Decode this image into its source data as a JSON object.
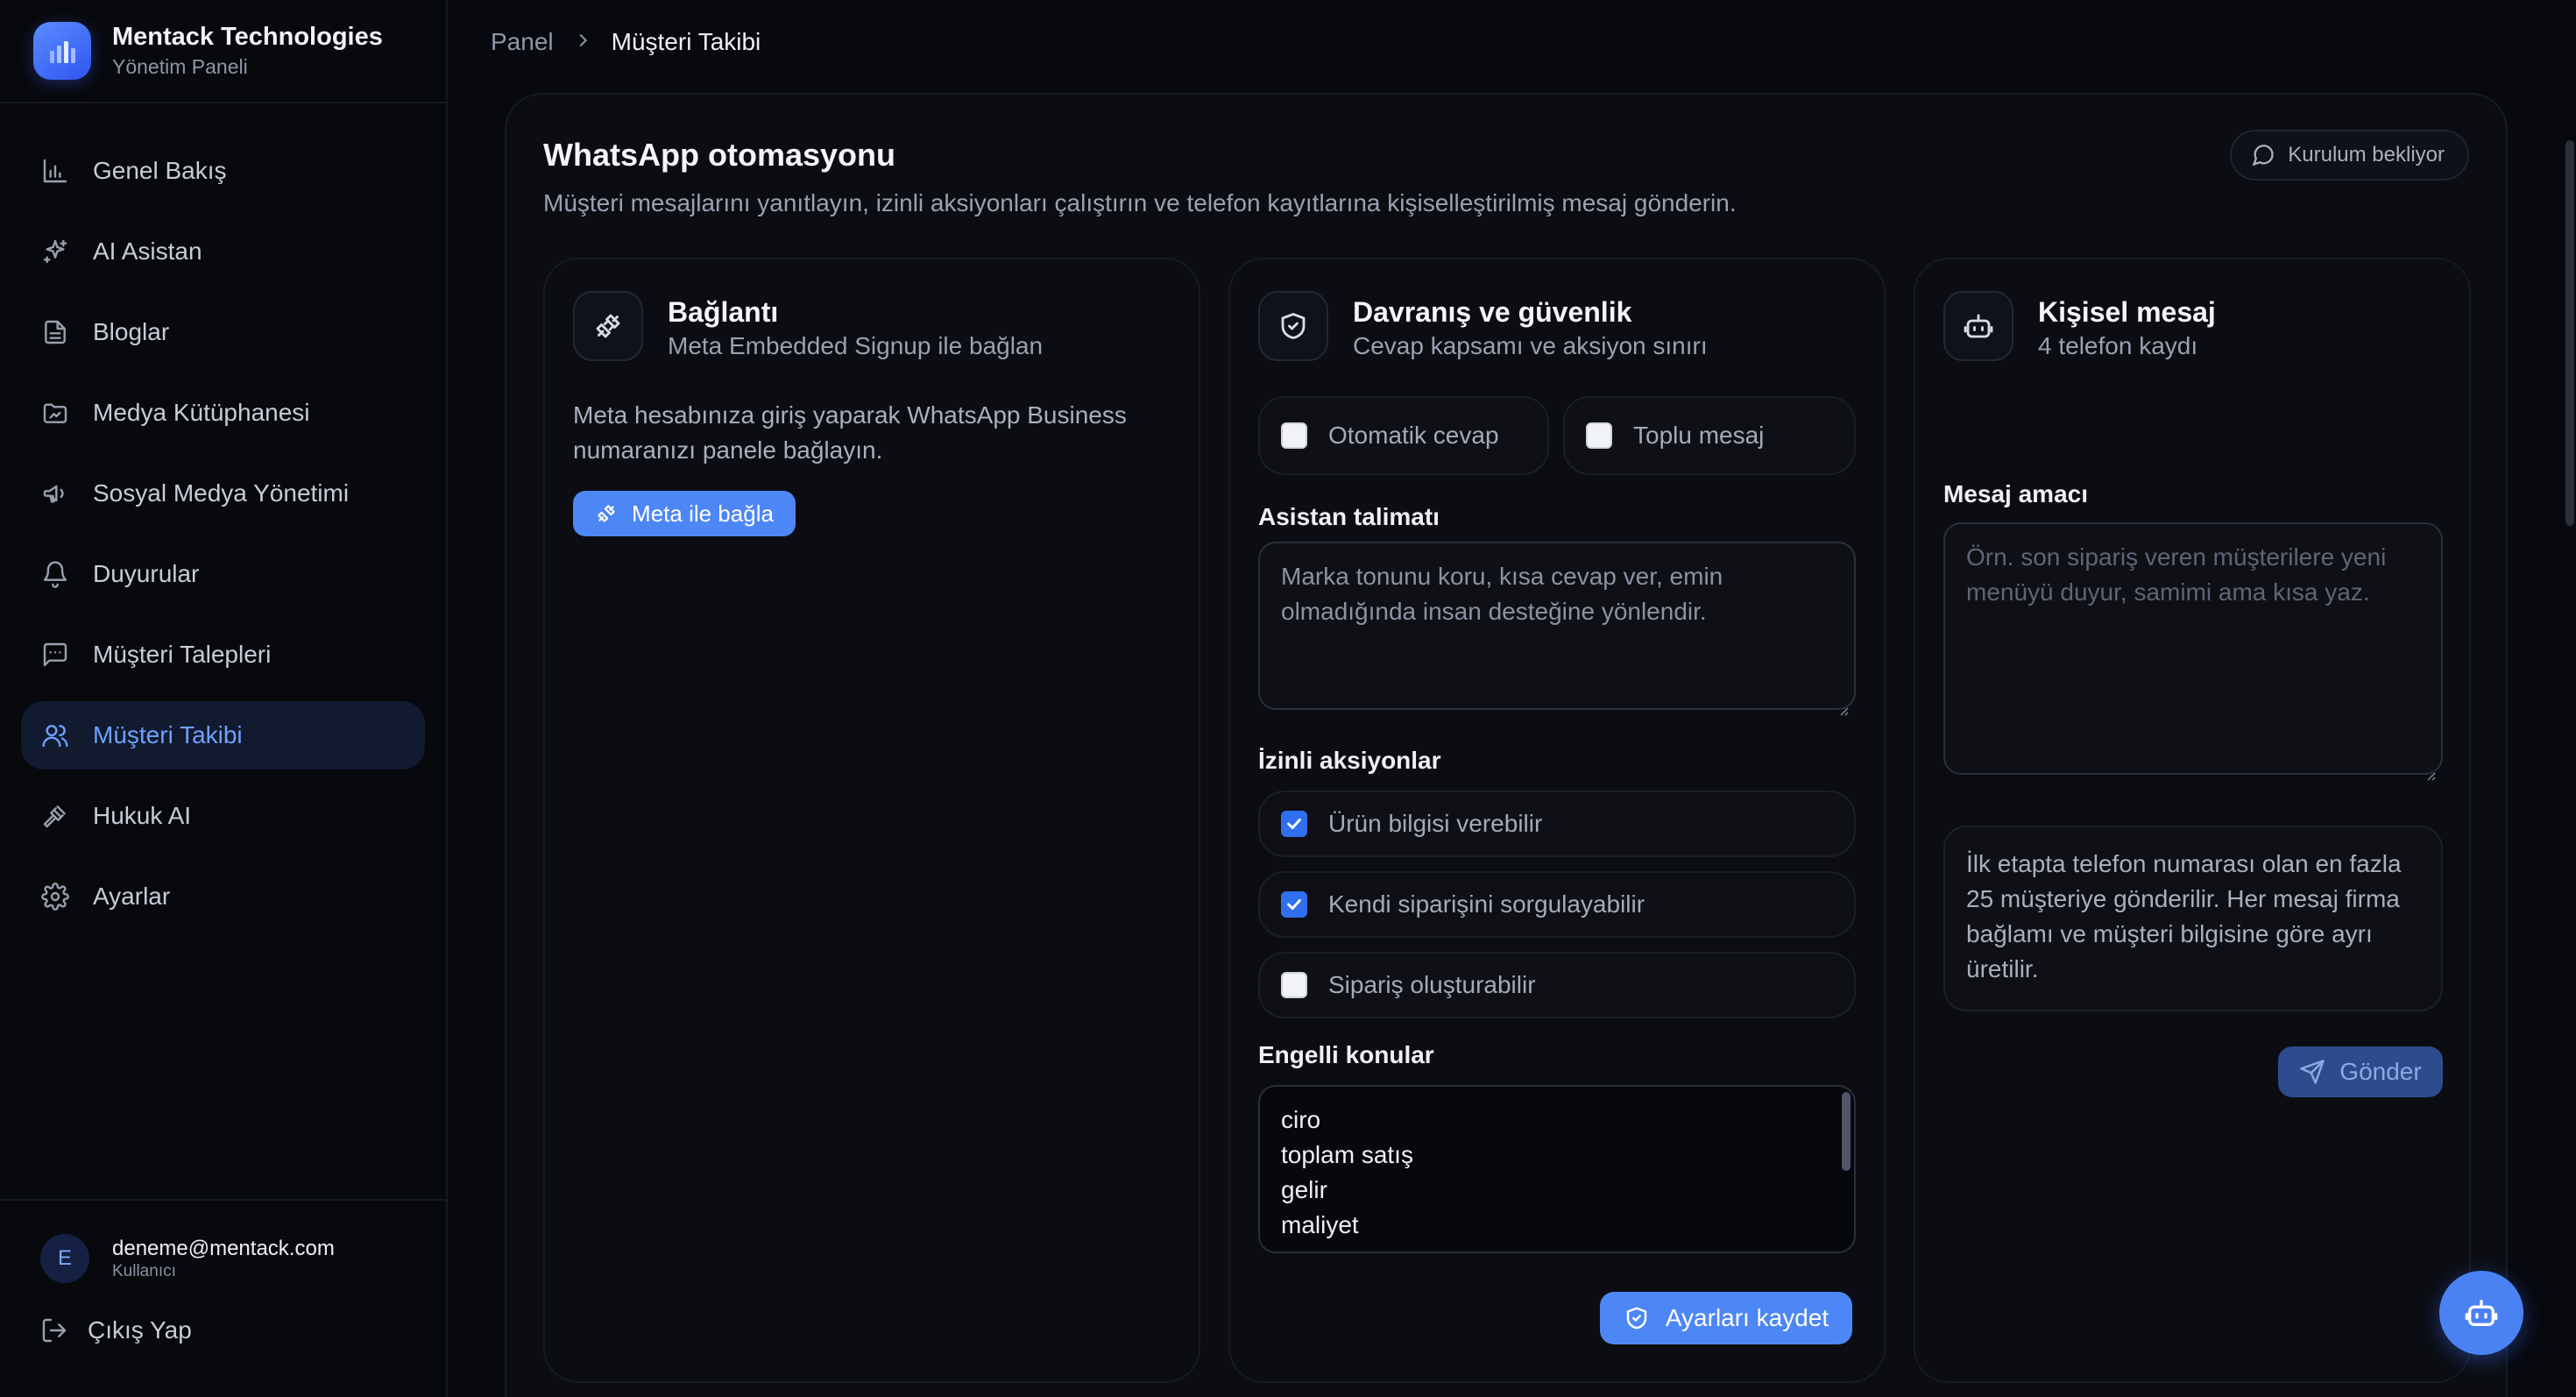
{
  "brand": {
    "name": "Mentack Technologies",
    "subtitle": "Yönetim Paneli"
  },
  "sidebar": {
    "items": [
      {
        "label": "Genel Bakış",
        "icon": "bar-chart-icon"
      },
      {
        "label": "AI Asistan",
        "icon": "sparkles-icon"
      },
      {
        "label": "Bloglar",
        "icon": "document-icon"
      },
      {
        "label": "Medya Kütüphanesi",
        "icon": "media-folder-icon"
      },
      {
        "label": "Sosyal Medya Yönetimi",
        "icon": "megaphone-icon"
      },
      {
        "label": "Duyurular",
        "icon": "bell-icon"
      },
      {
        "label": "Müşteri Talepleri",
        "icon": "message-square-icon"
      },
      {
        "label": "Müşteri Takibi",
        "icon": "users-icon",
        "active": true
      },
      {
        "label": "Hukuk AI",
        "icon": "gavel-icon"
      },
      {
        "label": "Ayarlar",
        "icon": "gear-icon"
      }
    ]
  },
  "user": {
    "initial": "E",
    "email": "deneme@mentack.com",
    "role": "Kullanıcı",
    "logout_label": "Çıkış Yap"
  },
  "breadcrumb": {
    "root": "Panel",
    "current": "Müşteri Takibi"
  },
  "page": {
    "title": "WhatsApp otomasyonu",
    "description": "Müşteri mesajlarını yanıtlayın, izinli aksiyonları çalıştırın ve telefon kayıtlarına kişiselleştirilmiş mesaj gönderin.",
    "status": "Kurulum bekliyor"
  },
  "connection": {
    "title": "Bağlantı",
    "subtitle": "Meta Embedded Signup ile bağlan",
    "text": "Meta hesabınıza giriş yaparak WhatsApp Business numaranızı panele bağlayın.",
    "button": "Meta ile bağla"
  },
  "behavior": {
    "title": "Davranış ve güvenlik",
    "subtitle": "Cevap kapsamı ve aksiyon sınırı",
    "toggles": [
      {
        "label": "Otomatik cevap",
        "checked": false
      },
      {
        "label": "Toplu mesaj",
        "checked": false
      }
    ],
    "instruction_label": "Asistan talimatı",
    "instruction_value": "Marka tonunu koru, kısa cevap ver, emin olmadığında insan desteğine yönlendir.",
    "permissions_label": "İzinli aksiyonlar",
    "permissions": [
      {
        "label": "Ürün bilgisi verebilir",
        "checked": true
      },
      {
        "label": "Kendi siparişini sorgulayabilir",
        "checked": true
      },
      {
        "label": "Sipariş oluşturabilir",
        "checked": false
      }
    ],
    "blocked_label": "Engelli konular",
    "blocked_topics": [
      "ciro",
      "toplam satış",
      "gelir",
      "maliyet"
    ],
    "save_button": "Ayarları kaydet"
  },
  "personal": {
    "title": "Kişisel mesaj",
    "subtitle": "4 telefon kaydı",
    "purpose_label": "Mesaj amacı",
    "purpose_placeholder": "Örn. son sipariş veren müşterilere yeni menüyü duyur, samimi ama kısa yaz.",
    "info": "İlk etapta telefon numarası olan en fazla 25 müşteriye gönderilir. Her mesaj firma bağlamı ve müşteri bilgisine göre ayrı üretilir.",
    "send_button": "Gönder"
  },
  "colors": {
    "accent": "#4d86f5",
    "active_text": "#6ea1ff",
    "background": "#07090e"
  }
}
